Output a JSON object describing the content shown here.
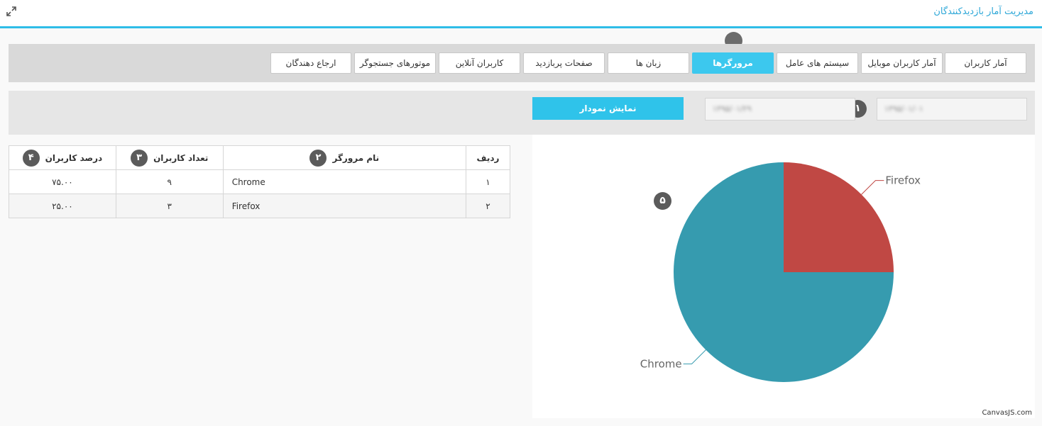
{
  "header": {
    "title": "مدیریت آمار بازدیدکنندگان"
  },
  "tabs": [
    {
      "label": "آمار کاربران",
      "active": false
    },
    {
      "label": "آمار کاربران موبایل",
      "active": false
    },
    {
      "label": "سیستم های عامل",
      "active": false
    },
    {
      "label": "مرورگرها",
      "active": true
    },
    {
      "label": "زبان ها",
      "active": false
    },
    {
      "label": "صفحات پربازدید",
      "active": false
    },
    {
      "label": "کاربران آنلاین",
      "active": false
    },
    {
      "label": "موتورهای جستجوگر",
      "active": false
    },
    {
      "label": "ارجاع دهندگان",
      "active": false
    }
  ],
  "filters": {
    "from_date": "۱۳۹۵/۰۱/۰۱",
    "to_date": "۱۳۹۵/۰۱/۲۹",
    "show_chart_label": "نمایش نمودار",
    "badge_1": "۱"
  },
  "table": {
    "headers": {
      "row": "ردیف",
      "browser": "نام مرورگر",
      "users": "تعداد کاربران",
      "percent": "درصد کاربران"
    },
    "badges": {
      "browser": "۲",
      "users": "۳",
      "percent": "۴"
    },
    "rows": [
      {
        "row": "۱",
        "browser": "Chrome",
        "users": "۹",
        "percent": "۷۵.۰۰"
      },
      {
        "row": "۲",
        "browser": "Firefox",
        "users": "۳",
        "percent": "۲۵.۰۰"
      }
    ]
  },
  "chart_badge": "۵",
  "chart_credit": "CanvasJS.com",
  "chart_data": {
    "type": "pie",
    "categories": [
      "Firefox",
      "Chrome"
    ],
    "values": [
      25,
      75
    ],
    "colors": [
      "#c04844",
      "#369baf"
    ],
    "title": "",
    "labels_outside": true
  }
}
